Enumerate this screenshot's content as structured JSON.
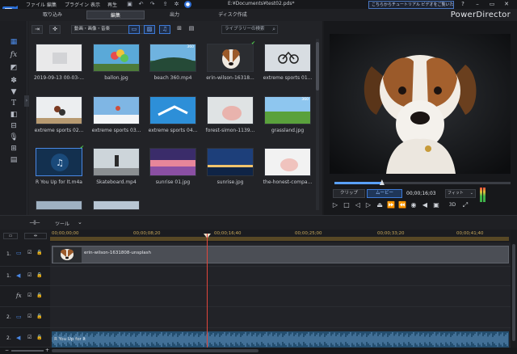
{
  "menu": [
    "ファイル",
    "編集",
    "プラグイン",
    "表示",
    "再生"
  ],
  "window_title": "E:¥Documents¥test02.pds*",
  "tutorial_text": "こちらからチュートリアル ビデオをご覧いただけます。",
  "brand": "PowerDirector",
  "modes": [
    "取り込み",
    "編集",
    "出力",
    "ディスク作成"
  ],
  "library": {
    "filter": "動画・画像・音楽",
    "search_placeholder": "ライブラリーの検索",
    "items": [
      {
        "label": "2019-09-13 00-03-...",
        "kind": "white",
        "check": false,
        "badge": ""
      },
      {
        "label": "ballon.jpg",
        "kind": "balloon",
        "check": false,
        "badge": ""
      },
      {
        "label": "beach 360.mp4",
        "kind": "beach",
        "check": false,
        "badge": "360"
      },
      {
        "label": "erin-wilson-16318...",
        "kind": "dog",
        "check": true,
        "badge": ""
      },
      {
        "label": "extreme sports 01...",
        "kind": "bike",
        "check": false,
        "badge": ""
      },
      {
        "label": "extreme sports 02...",
        "kind": "moto",
        "check": false,
        "badge": ""
      },
      {
        "label": "extreme sports 03...",
        "kind": "ski",
        "check": false,
        "badge": ""
      },
      {
        "label": "extreme sports 04...",
        "kind": "sky",
        "check": false,
        "badge": ""
      },
      {
        "label": "forest-simon-1139...",
        "kind": "pig",
        "check": false,
        "badge": ""
      },
      {
        "label": "grassland.jpg",
        "kind": "grass",
        "check": false,
        "badge": "360"
      },
      {
        "label": "R You Up for It.m4a",
        "kind": "music",
        "check": true,
        "badge": ""
      },
      {
        "label": "Skateboard.mp4",
        "kind": "skate",
        "check": false,
        "badge": ""
      },
      {
        "label": "sunrise 01.jpg",
        "kind": "sunrise",
        "check": false,
        "badge": ""
      },
      {
        "label": "sunrise.jpg",
        "kind": "sunrise2",
        "check": false,
        "badge": ""
      },
      {
        "label": "the-honest-compa...",
        "kind": "pig2",
        "check": false,
        "badge": ""
      },
      {
        "label": "",
        "kind": "partial1",
        "check": false,
        "badge": ""
      },
      {
        "label": "",
        "kind": "partial2",
        "check": false,
        "badge": ""
      }
    ]
  },
  "preview": {
    "clip_label": "クリップ",
    "movie_label": "ムービー",
    "timecode": "00;00;16;03",
    "fit_label": "フィット",
    "mode_3d": "3D",
    "scrub_fraction": 0.27
  },
  "timeline": {
    "tools_label": "ツール",
    "ruler_ticks": [
      "00;00;00;00",
      "00;00;08;20",
      "00;00;16;40",
      "00;00;25;00",
      "00;00;33;20",
      "00;00;41;40"
    ],
    "video_clip_label": "erin-wilson-1631808-unsplash",
    "audio_clip_label": "R You Up for It",
    "tracks": [
      {
        "num": "1.",
        "icon": "video-track-icon"
      },
      {
        "num": "1.",
        "icon": "audio-track-icon"
      },
      {
        "num": "",
        "icon": "fx-track-icon"
      },
      {
        "num": "2.",
        "icon": "video-track-icon"
      },
      {
        "num": "2.",
        "icon": "audio-track-icon"
      }
    ]
  }
}
